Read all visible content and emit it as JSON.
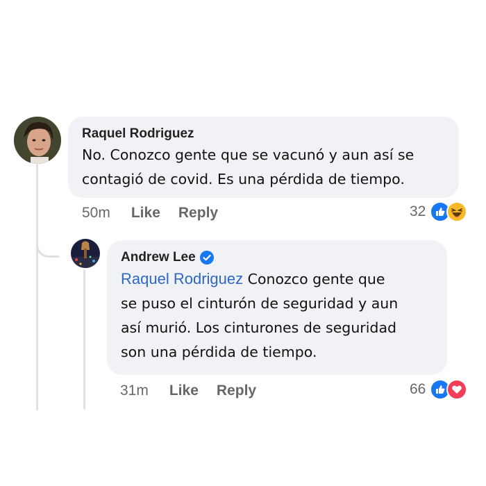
{
  "comments": [
    {
      "author": "Raquel Rodriguez",
      "text_lines": [
        "No. Conozco gente que se vacunó y aun así se",
        "contagió de covid. Es una pérdida de tiempo."
      ],
      "time": "50m",
      "like_label": "Like",
      "reply_label": "Reply",
      "reaction_count": "32",
      "reactions": [
        "like-icon",
        "haha-icon"
      ]
    },
    {
      "author": "Andrew Lee",
      "verified": true,
      "mention": "Raquel Rodriguez",
      "text_first": "Conozco gente que",
      "text_lines": [
        "se puso el cinturón de seguridad y aun",
        "así murió. Los cinturones de seguridad",
        "son una pérdida de tiempo."
      ],
      "time": "31m",
      "like_label": "Like",
      "reply_label": "Reply",
      "reaction_count": "66",
      "reactions": [
        "like-icon",
        "love-icon"
      ]
    }
  ],
  "colors": {
    "bubble": "#f0f2f5",
    "mention": "#2d66c4",
    "meta": "#65676b",
    "like": "#1877f2",
    "love": "#f33e58",
    "haha": "#f7b928",
    "verified": "#1877f2"
  }
}
